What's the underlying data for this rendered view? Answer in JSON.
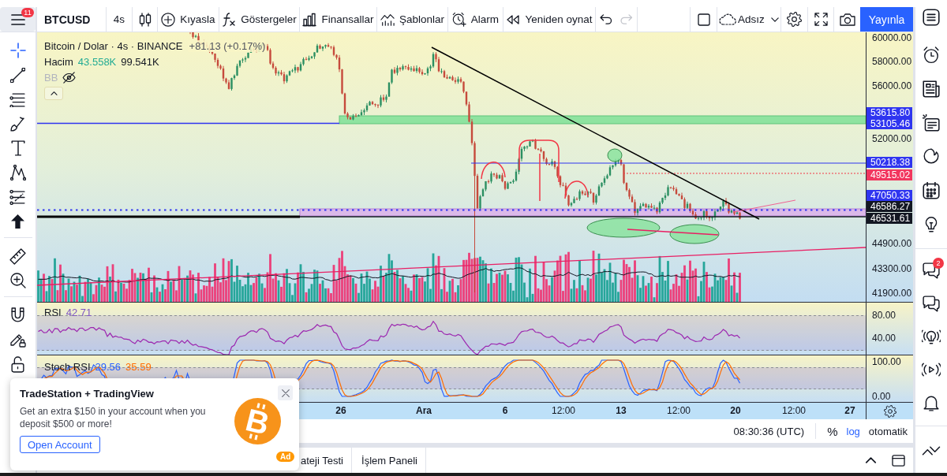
{
  "header": {
    "menu_badge": "11",
    "symbol": "BTCUSD",
    "interval": "4s",
    "buttons": [
      {
        "kind": "compare",
        "label": "Kıyasla"
      },
      {
        "kind": "indicators",
        "label": "Göstergeler"
      },
      {
        "kind": "financials",
        "label": "Finansallar"
      },
      {
        "kind": "templates",
        "label": "Şablonlar"
      },
      {
        "kind": "alert",
        "label": "Alarm"
      },
      {
        "kind": "replay",
        "label": "Yeniden oynat"
      }
    ],
    "history": [
      {
        "kind": "undo",
        "disabled": false
      },
      {
        "kind": "redo",
        "disabled": true
      }
    ],
    "layout_name": "Adsız",
    "publish": "Yayınla"
  },
  "left_toolbar": {
    "tools": [
      {
        "kind": "crosshair",
        "selected": true
      },
      {
        "kind": "trend_line",
        "selected": false
      },
      {
        "kind": "fib",
        "selected": false
      },
      {
        "kind": "brush",
        "selected": false
      },
      {
        "kind": "text",
        "selected": false
      },
      {
        "kind": "pattern",
        "selected": false
      },
      {
        "kind": "forecast",
        "selected": false
      },
      {
        "kind": "arrow",
        "selected": false
      },
      {
        "kind": "ruler",
        "selected": false
      },
      {
        "kind": "zoom",
        "selected": false
      },
      {
        "kind": "magnet",
        "selected": false
      },
      {
        "kind": "lock_drawings",
        "selected": false
      },
      {
        "kind": "lock",
        "selected": false
      }
    ]
  },
  "legend": {
    "title": "Bitcoin / Dolar · 4s · BINANCE",
    "change": "+81.13 (+0.17%)",
    "volume": {
      "label": "Hacim",
      "values": [
        "43.558K",
        "99.541K"
      ]
    },
    "indicator": {
      "name": "BB",
      "hidden": true
    }
  },
  "price_axis": {
    "ticks": [
      "60000.00",
      "58000.00",
      "56000.00",
      "52000.00",
      "44900.00",
      "43300.00",
      "41900.00"
    ],
    "tags": [
      {
        "label": "53615.80",
        "color": "#2f35f0"
      },
      {
        "label": "53105.46",
        "color": "#2f35f0"
      },
      {
        "label": "50218.38",
        "color": "#2f35f0"
      },
      {
        "label": "49515.02",
        "color": "#f2365f"
      },
      {
        "label": "47050.33",
        "color": "#2f35f0"
      },
      {
        "label": "46586.27",
        "color": "#131722"
      },
      {
        "label": "46531.61",
        "color": "#131722"
      }
    ]
  },
  "rsi": {
    "name": "RSI",
    "value": "42.71",
    "ticks": [
      "80.00",
      "40.00"
    ]
  },
  "stoch_rsi": {
    "name": "Stoch RSI",
    "lines": [
      {
        "value": "29.56",
        "color": "#2962ff"
      },
      {
        "value": "35.59",
        "color": "#ff6d00"
      }
    ],
    "ticks": [
      "100.00",
      "0.00"
    ]
  },
  "time_axis": {
    "labels": [
      {
        "text": "26",
        "kind": "day"
      },
      {
        "text": "Ara",
        "kind": "month"
      },
      {
        "text": "6",
        "kind": "day"
      },
      {
        "text": "12:00",
        "kind": "time"
      },
      {
        "text": "13",
        "kind": "day"
      },
      {
        "text": "12:00",
        "kind": "time"
      },
      {
        "text": "20",
        "kind": "day"
      },
      {
        "text": "12:00",
        "kind": "time"
      },
      {
        "text": "27",
        "kind": "day"
      }
    ]
  },
  "status_bar": {
    "clock": "08:30:36 (UTC)",
    "scale_options": [
      {
        "label": "%",
        "selected": false
      },
      {
        "label": "log",
        "selected": true
      },
      {
        "label": "otomatik",
        "selected": false
      }
    ]
  },
  "bottom_panel": {
    "tabs": [
      {
        "label": "ateji Testi",
        "selected": false
      },
      {
        "label": "İşlem Paneli",
        "selected": false
      }
    ]
  },
  "right_sidebar": {
    "chat_badge": "2"
  },
  "ad": {
    "title": "TradeStation + TradingView",
    "body": "Get an extra $150 in your account when you deposit $500 or more!",
    "button": "Open Account",
    "logo": "B",
    "badge": "Ad"
  }
}
